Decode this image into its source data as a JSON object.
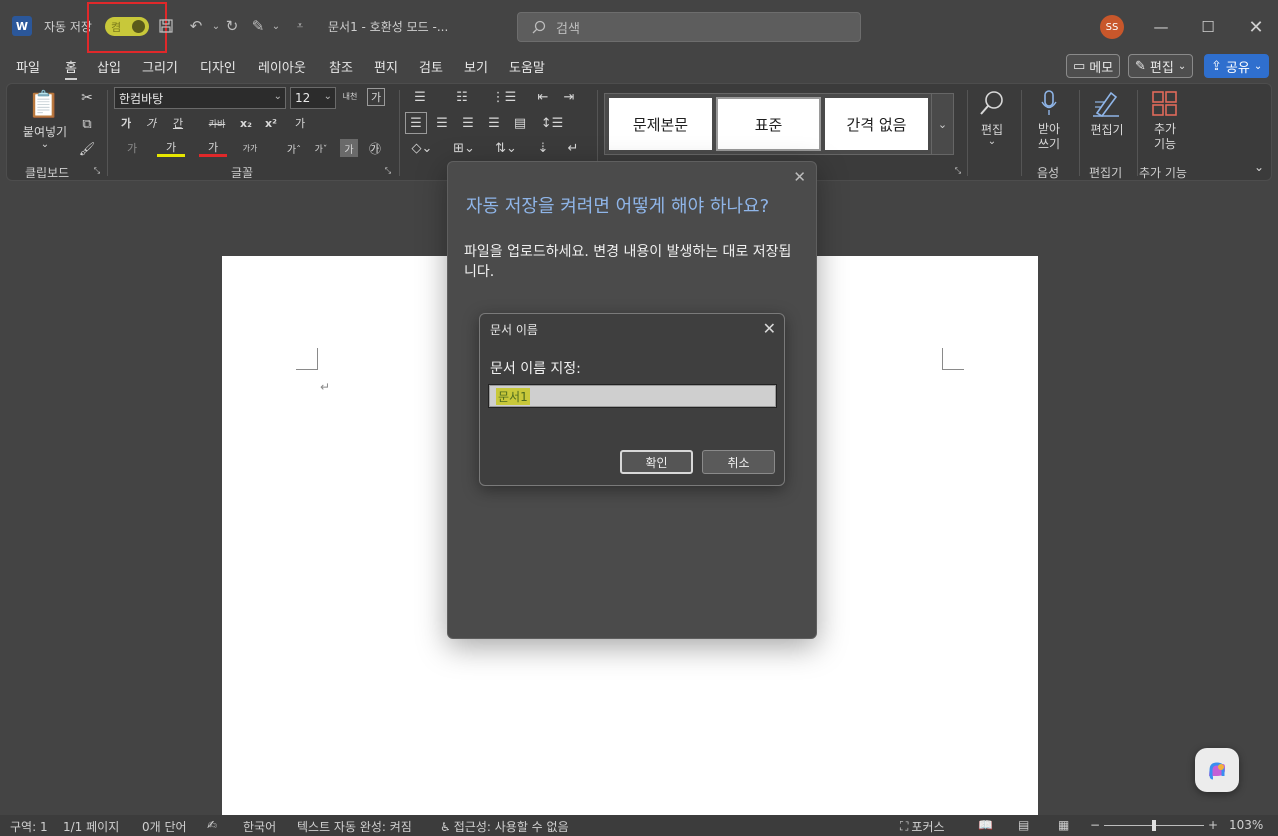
{
  "titlebar": {
    "autosave_label": "자동 저장",
    "autosave_toggle": "켬",
    "doc_title": "문서1  -  호환성 모드  -...",
    "search_placeholder": "검색",
    "avatar": "SS",
    "icons": [
      "save-icon",
      "undo-icon",
      "redo-icon",
      "format-icon",
      "customize-icon"
    ]
  },
  "menu": {
    "tabs": [
      "파일",
      "홈",
      "삽입",
      "그리기",
      "디자인",
      "레이아웃",
      "참조",
      "편지",
      "검토",
      "보기",
      "도움말"
    ],
    "active": "홈",
    "memo": "메모",
    "edit": "편집",
    "share": "공유"
  },
  "ribbon": {
    "clipboard": {
      "paste": "붙여넣기",
      "label": "클립보드"
    },
    "font": {
      "name": "한컴바탕",
      "size": "12",
      "bold": "가",
      "italic": "가",
      "underline": "간",
      "strike": "카바",
      "subscript": "x₂",
      "superscript": "x²",
      "clear": "가",
      "effects": "가",
      "highlight": "가",
      "color": "가",
      "charspace": "가가",
      "grow": "가ˆ",
      "shrink": "가ˇ",
      "shade": "가",
      "enclose": "㉮",
      "phonetic": "내천",
      "border_char": "가",
      "label": "글꼴"
    },
    "styles": [
      "문제본문",
      "표준",
      "간격 없음"
    ],
    "editing": {
      "label": "편집"
    },
    "voice": {
      "dictate": "받아\n쓰기",
      "label": "음성"
    },
    "editor": {
      "name": "편집기",
      "label": "편집기"
    },
    "addins": {
      "name": "추가\n기능",
      "label": "추가 기능"
    }
  },
  "autosave_dialog": {
    "title": "자동 저장을 켜려면 어떻게 해야 하나요?",
    "body": "파일을 업로드하세요. 변경 내용이 발생하는 대로 저장됩니다."
  },
  "rename_dialog": {
    "title": "문서 이름",
    "label": "문서 이름 지정:",
    "value": "문서1",
    "ok": "확인",
    "cancel": "취소"
  },
  "statusbar": {
    "section": "구역: 1",
    "pages": "1/1 페이지",
    "words": "0개 단어",
    "language": "한국어",
    "autocomplete": "텍스트 자동 완성: 켜짐",
    "accessibility": "접근성: 사용할 수 없음",
    "focus": "포커스",
    "zoom": "103%",
    "zoom_level": 103
  },
  "colors": {
    "accent": "#2f6fce",
    "highlight": "#c8c83a",
    "annotation": "#e0282a",
    "dialog_title": "#8fb5e8"
  }
}
